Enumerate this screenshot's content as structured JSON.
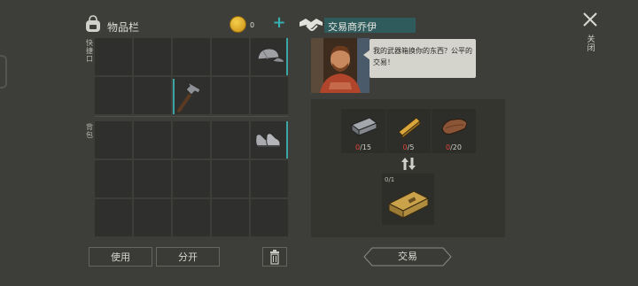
{
  "inventory": {
    "title": "物品栏",
    "coins": "0",
    "quick_label": "快捷口",
    "backpack_label": "背包",
    "actions": {
      "use": "使用",
      "split": "分开"
    }
  },
  "trader": {
    "title": "交易商乔伊",
    "dialog": "我的武器箱换你的东西？公平的交易！",
    "requirements": [
      {
        "icon": "metal-ingot-icon",
        "have": "0",
        "need": "/15"
      },
      {
        "icon": "wood-plank-icon",
        "have": "0",
        "need": "/5"
      },
      {
        "icon": "leather-icon",
        "have": "0",
        "need": "/20"
      }
    ],
    "result_count": "0/1",
    "trade_button": "交易"
  },
  "close_label": "关闭",
  "colors": {
    "accent": "#3aa5a3",
    "shortage": "#e0443a",
    "title_bar": "#2f5b5c"
  }
}
